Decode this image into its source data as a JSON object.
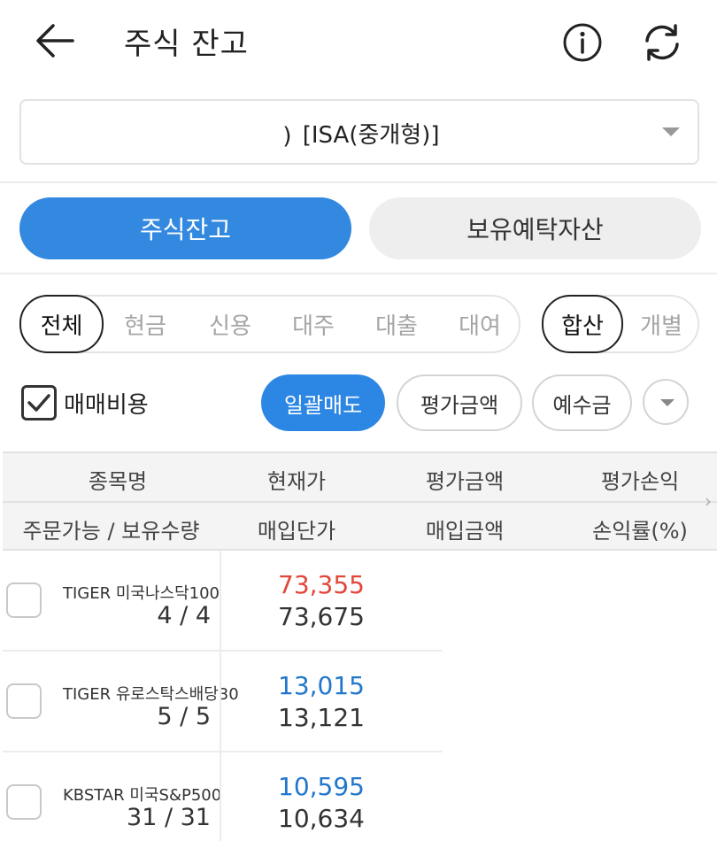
{
  "header": {
    "title": "주식 잔고"
  },
  "account": {
    "label": "[ISA(중개형)]"
  },
  "main_tabs": [
    {
      "label": "주식잔고",
      "active": true
    },
    {
      "label": "보유예탁자산",
      "active": false
    }
  ],
  "filter_type": {
    "items": [
      "전체",
      "현금",
      "신용",
      "대주",
      "대출",
      "대여"
    ],
    "selected": "전체"
  },
  "filter_view": {
    "items": [
      "합산",
      "개별"
    ],
    "selected": "합산"
  },
  "options": {
    "fee_label": "매매비용",
    "fee_checked": true,
    "sell_all": "일괄매도",
    "eval_amount": "평가금액",
    "deposit": "예수금"
  },
  "table": {
    "headers_top": [
      "종목명",
      "현재가",
      "평가금액",
      "평가손익"
    ],
    "headers_bottom": [
      "주문가능 / 보유수량",
      "매입단가",
      "매입금액",
      "손익률(%)"
    ],
    "rows": [
      {
        "name": "TIGER 미국나스닥100",
        "qty": "4 / 4",
        "price": "73,355",
        "trend": "up",
        "buy_price": "73,675"
      },
      {
        "name": "TIGER 유로스탁스배당30",
        "qty": "5 / 5",
        "price": "13,015",
        "trend": "down",
        "buy_price": "13,121"
      },
      {
        "name": "KBSTAR 미국S&P500",
        "qty": "31 / 31",
        "price": "10,595",
        "trend": "down",
        "buy_price": "10,634"
      }
    ]
  },
  "colors": {
    "accent": "#3389e0",
    "price_up": "#e2473a",
    "price_down": "#2277cc"
  }
}
